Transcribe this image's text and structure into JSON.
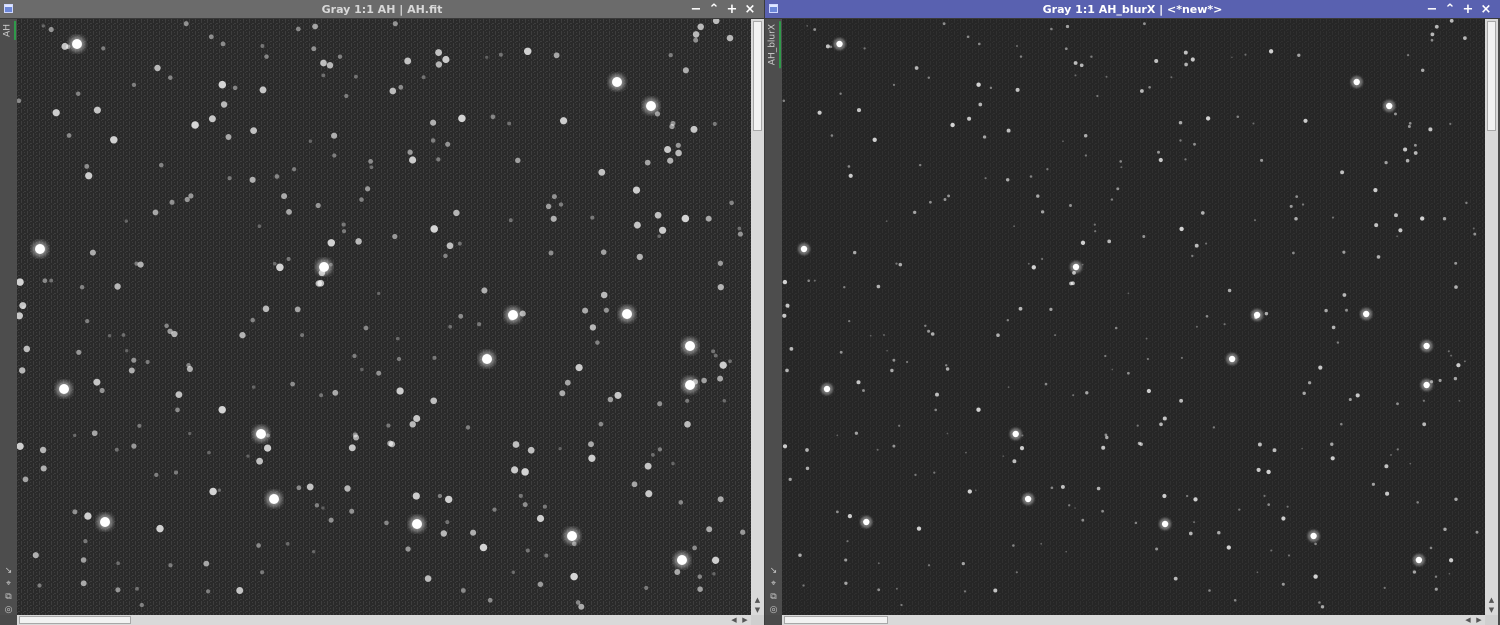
{
  "windows": [
    {
      "id": "left",
      "title": "Gray 1:1 AH | AH.fit",
      "tab_label": "AH",
      "active": false,
      "controls": [
        "−",
        "⌃",
        "+",
        "×"
      ],
      "image": {
        "background": "#2a2a2a",
        "noise": "#3d3d3d",
        "star_color": "#ffffff"
      }
    },
    {
      "id": "right",
      "title": "Gray 1:1 AH_blurX | <*new*>",
      "tab_label": "AH_blurX",
      "active": true,
      "controls": [
        "−",
        "⌃",
        "+",
        "×"
      ],
      "image": {
        "background": "#262626",
        "noise": "#303030",
        "star_color": "#ffffff"
      }
    }
  ],
  "sidebar_icons": [
    "↘",
    "⌖",
    "⧉",
    "◎"
  ],
  "colors": {
    "active_title": "#5961b0",
    "inactive_title": "#6b6b6b",
    "tab_accent": "#2f9a4a",
    "scrollbar": "#d9d9d9"
  }
}
